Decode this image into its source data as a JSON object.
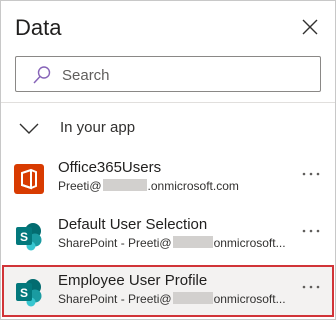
{
  "pane": {
    "title": "Data",
    "close_icon": "close-icon"
  },
  "search": {
    "placeholder": "Search",
    "value": "",
    "icon": "search-icon"
  },
  "section": {
    "label": "In your app",
    "icon": "chevron-down-icon"
  },
  "items": [
    {
      "name": "Office365Users",
      "account_prefix": "Preeti@",
      "account_suffix": ".onmicrosoft.com",
      "icon": "office-icon",
      "icon_color": "#d83b01"
    },
    {
      "name": "Default User Selection",
      "account_prefix": "SharePoint - Preeti@",
      "account_suffix": "onmicrosoft...",
      "icon": "sharepoint-icon",
      "icon_color": "#036c70"
    },
    {
      "name": "Employee User Profile",
      "account_prefix": "SharePoint - Preeti@",
      "account_suffix": "onmicrosoft...",
      "icon": "sharepoint-icon",
      "icon_color": "#036c70",
      "selected": true
    }
  ],
  "more_label": "..."
}
